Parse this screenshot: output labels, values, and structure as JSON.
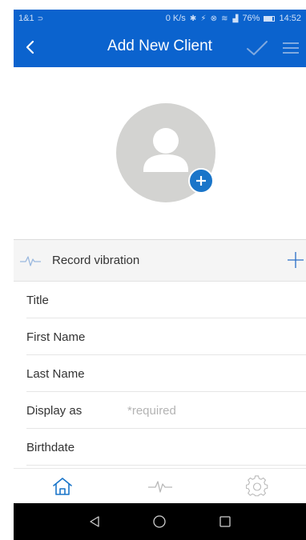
{
  "status_bar": {
    "carrier": "1&1",
    "network_speed": "0 K/s",
    "signal_icons": "✱ ⚡ ⊗ ≋",
    "battery_percent": "76%",
    "battery_level": 0.76,
    "time": "14:52"
  },
  "app_bar": {
    "title": "Add New Client",
    "back_icon": "chevron-left-icon",
    "confirm_icon": "checkmark-icon",
    "menu_icon": "hamburger-menu-icon"
  },
  "avatar": {
    "icon": "person-icon",
    "add_icon": "plus-circle-icon"
  },
  "record_vibration": {
    "label": "Record vibration",
    "icon": "waveform-icon",
    "add_icon": "plus-icon"
  },
  "fields": [
    {
      "label": "Title",
      "value": "",
      "placeholder": ""
    },
    {
      "label": "First Name",
      "value": "",
      "placeholder": ""
    },
    {
      "label": "Last Name",
      "value": "",
      "placeholder": ""
    },
    {
      "label": "Display as",
      "value": "",
      "placeholder": "*required"
    },
    {
      "label": "Birthdate",
      "value": "",
      "placeholder": ""
    }
  ],
  "tabs": [
    {
      "icon": "home-icon",
      "active": true
    },
    {
      "icon": "waveform-icon",
      "active": false
    },
    {
      "icon": "settings-gear-icon",
      "active": false
    }
  ],
  "nav_bar": {
    "back_icon": "triangle-back-icon",
    "home_icon": "circle-home-icon",
    "recents_icon": "square-recents-icon"
  },
  "colors": {
    "primary": "#0b63ce",
    "accent": "#1a75c9",
    "avatar_bg": "#d3d3d1",
    "tab_active": "#1a75c9",
    "tab_inactive": "#b8b8b8"
  }
}
